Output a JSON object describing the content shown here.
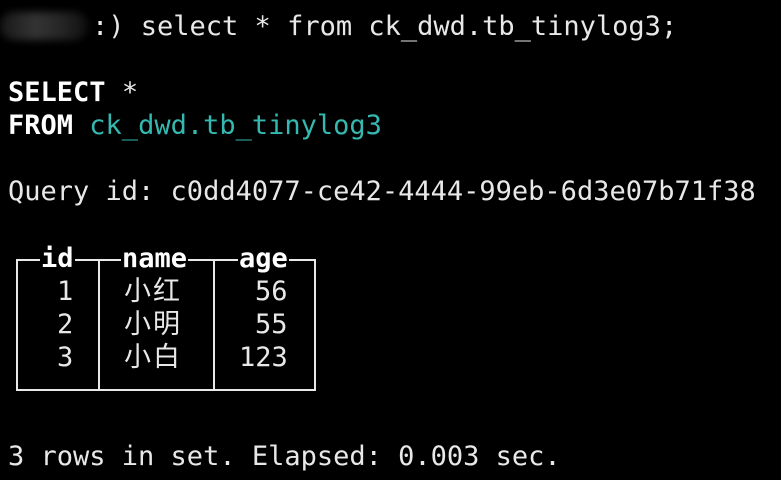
{
  "prompt": {
    "suffix": ":) select * from ck_dwd.tb_tinylog3;"
  },
  "query": {
    "select_kw": "SELECT",
    "select_star": "*",
    "from_kw": "FROM",
    "table_name": "ck_dwd.tb_tinylog3"
  },
  "query_id_line": "Query id: c0dd4077-ce42-4444-99eb-6d3e07b71f38",
  "result": {
    "columns": [
      "id",
      "name",
      "age"
    ],
    "rows": [
      {
        "id": "1",
        "name": "小红",
        "age": "56"
      },
      {
        "id": "2",
        "name": "小明",
        "age": "55"
      },
      {
        "id": "3",
        "name": "小白",
        "age": "123"
      }
    ]
  },
  "summary": "3 rows in set. Elapsed: 0.003 sec.",
  "colors": {
    "background": "#000000",
    "text": "#e8e8e8",
    "table_name": "#35b8b0"
  }
}
